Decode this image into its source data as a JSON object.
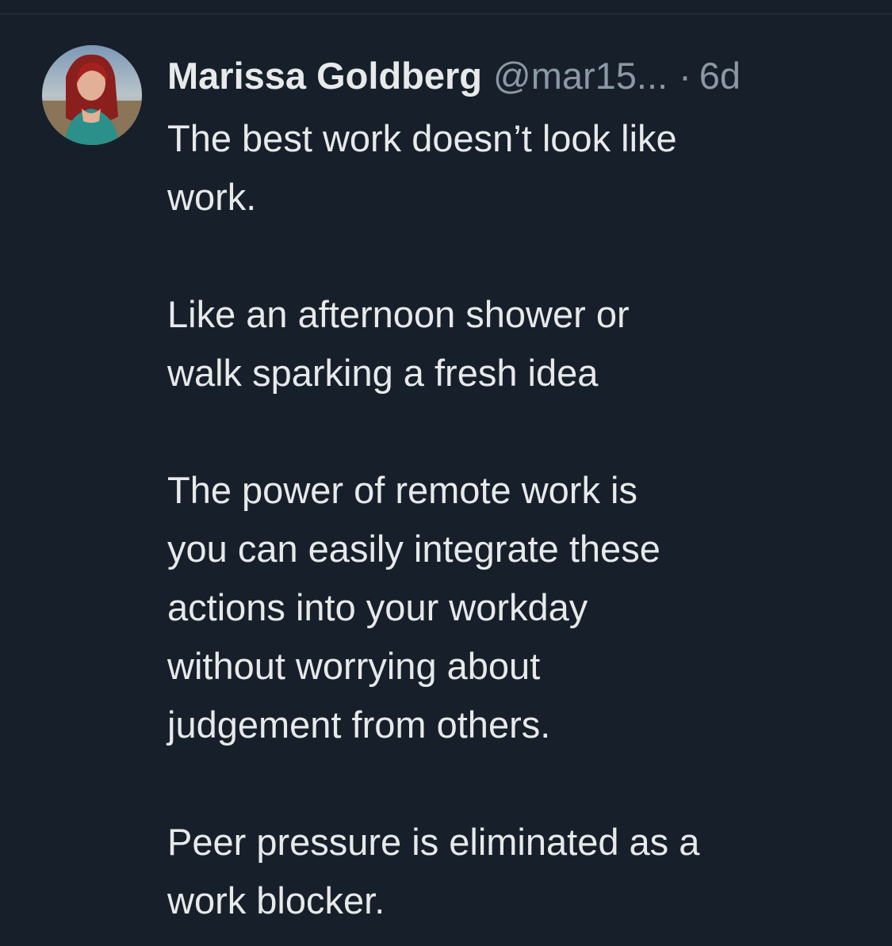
{
  "tweet": {
    "author_name": "Marissa Goldberg",
    "author_handle": "@mar15...",
    "separator": "·",
    "timestamp": "6d",
    "paragraphs": [
      {
        "lines": [
          "The best work doesn’t look like",
          "work."
        ]
      },
      {
        "lines": [
          "Like an afternoon shower or",
          "walk sparking a fresh idea"
        ]
      },
      {
        "lines": [
          "The power of remote work is",
          "you can easily integrate these",
          "actions into your workday",
          "without worrying about",
          "judgement from others."
        ]
      },
      {
        "lines": [
          "Peer pressure is eliminated as a",
          "work blocker."
        ]
      }
    ]
  },
  "colors": {
    "background": "#17202a",
    "primary_text": "#e7e9ea",
    "secondary_text": "#8b98a5"
  }
}
